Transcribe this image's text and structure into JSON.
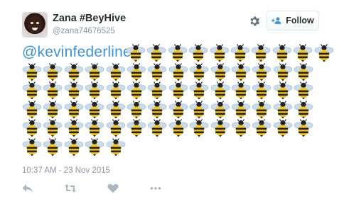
{
  "user": {
    "fullname": "Zana #BeyHive",
    "username": "@zana74676525"
  },
  "follow_button": {
    "label": "Follow",
    "icon": "add-user-icon"
  },
  "settings_icon": "gear-icon",
  "tweet": {
    "mention": "@kevinfederline",
    "emoji": "bee",
    "emoji_rows": [
      10,
      14,
      14,
      14,
      14,
      5
    ],
    "timestamp": "10:37 AM - 23 Nov 2015"
  },
  "actions": [
    {
      "name": "reply",
      "icon": "reply-icon"
    },
    {
      "name": "retweet",
      "icon": "retweet-icon"
    },
    {
      "name": "like",
      "icon": "heart-icon"
    },
    {
      "name": "more",
      "icon": "more-dots-icon"
    }
  ],
  "colors": {
    "link": "#3b94d9",
    "meta": "#8899a6",
    "action": "#aab8c2"
  }
}
